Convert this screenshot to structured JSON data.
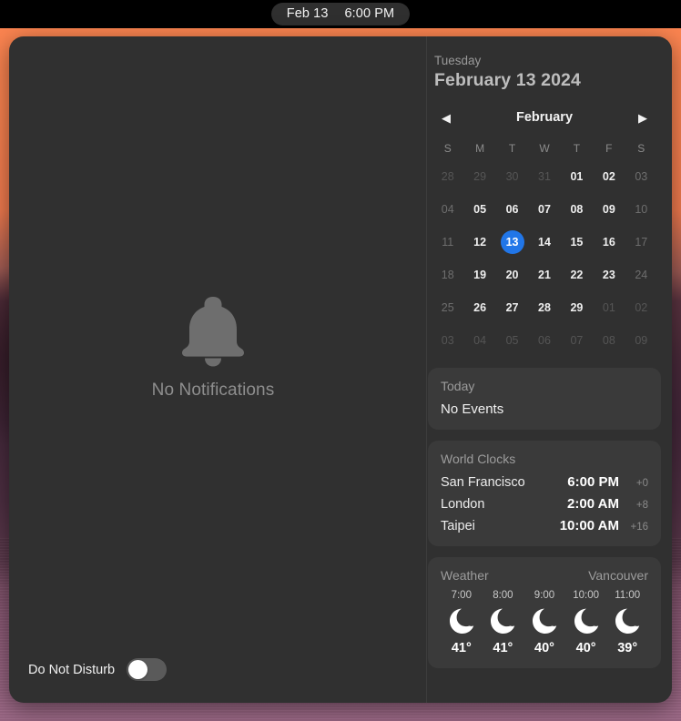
{
  "menubar": {
    "date": "Feb 13",
    "time": "6:00 PM"
  },
  "notifications": {
    "icon": "bell-icon",
    "empty_text": "No Notifications",
    "do_not_disturb": {
      "label": "Do Not Disturb",
      "enabled": false
    }
  },
  "date_header": {
    "weekday": "Tuesday",
    "long_date": "February 13 2024"
  },
  "calendar": {
    "prev_icon": "chevron-left-icon",
    "next_icon": "chevron-right-icon",
    "month_label": "February",
    "weekday_labels": [
      "S",
      "M",
      "T",
      "W",
      "T",
      "F",
      "S"
    ],
    "selected_day": "13",
    "accent_color": "#2176e8",
    "weeks": [
      [
        {
          "day": "28",
          "state": "out"
        },
        {
          "day": "29",
          "state": "out"
        },
        {
          "day": "30",
          "state": "out"
        },
        {
          "day": "31",
          "state": "out"
        },
        {
          "day": "01",
          "state": "normal"
        },
        {
          "day": "02",
          "state": "normal"
        },
        {
          "day": "03",
          "state": "dim"
        }
      ],
      [
        {
          "day": "04",
          "state": "dim"
        },
        {
          "day": "05",
          "state": "normal"
        },
        {
          "day": "06",
          "state": "normal"
        },
        {
          "day": "07",
          "state": "normal"
        },
        {
          "day": "08",
          "state": "normal"
        },
        {
          "day": "09",
          "state": "normal"
        },
        {
          "day": "10",
          "state": "dim"
        }
      ],
      [
        {
          "day": "11",
          "state": "dim"
        },
        {
          "day": "12",
          "state": "normal"
        },
        {
          "day": "13",
          "state": "today"
        },
        {
          "day": "14",
          "state": "normal"
        },
        {
          "day": "15",
          "state": "normal"
        },
        {
          "day": "16",
          "state": "normal"
        },
        {
          "day": "17",
          "state": "dim"
        }
      ],
      [
        {
          "day": "18",
          "state": "dim"
        },
        {
          "day": "19",
          "state": "normal"
        },
        {
          "day": "20",
          "state": "normal"
        },
        {
          "day": "21",
          "state": "normal"
        },
        {
          "day": "22",
          "state": "normal"
        },
        {
          "day": "23",
          "state": "normal"
        },
        {
          "day": "24",
          "state": "dim"
        }
      ],
      [
        {
          "day": "25",
          "state": "dim"
        },
        {
          "day": "26",
          "state": "normal"
        },
        {
          "day": "27",
          "state": "normal"
        },
        {
          "day": "28",
          "state": "normal"
        },
        {
          "day": "29",
          "state": "normal"
        },
        {
          "day": "01",
          "state": "out"
        },
        {
          "day": "02",
          "state": "out"
        }
      ],
      [
        {
          "day": "03",
          "state": "out"
        },
        {
          "day": "04",
          "state": "out"
        },
        {
          "day": "05",
          "state": "out"
        },
        {
          "day": "06",
          "state": "out"
        },
        {
          "day": "07",
          "state": "out"
        },
        {
          "day": "08",
          "state": "out"
        },
        {
          "day": "09",
          "state": "out"
        }
      ]
    ]
  },
  "today_card": {
    "title": "Today",
    "body": "No Events"
  },
  "world_clocks": {
    "title": "World Clocks",
    "rows": [
      {
        "city": "San Francisco",
        "time": "6:00 PM",
        "offset": "+0"
      },
      {
        "city": "London",
        "time": "2:00 AM",
        "offset": "+8"
      },
      {
        "city": "Taipei",
        "time": "10:00 AM",
        "offset": "+16"
      }
    ]
  },
  "weather": {
    "title": "Weather",
    "location": "Vancouver",
    "hours": [
      {
        "hour": "7:00",
        "icon": "moon-icon",
        "temp": "41°"
      },
      {
        "hour": "8:00",
        "icon": "moon-icon",
        "temp": "41°"
      },
      {
        "hour": "9:00",
        "icon": "moon-icon",
        "temp": "40°"
      },
      {
        "hour": "10:00",
        "icon": "moon-icon",
        "temp": "40°"
      },
      {
        "hour": "11:00",
        "icon": "moon-icon",
        "temp": "39°"
      }
    ]
  }
}
